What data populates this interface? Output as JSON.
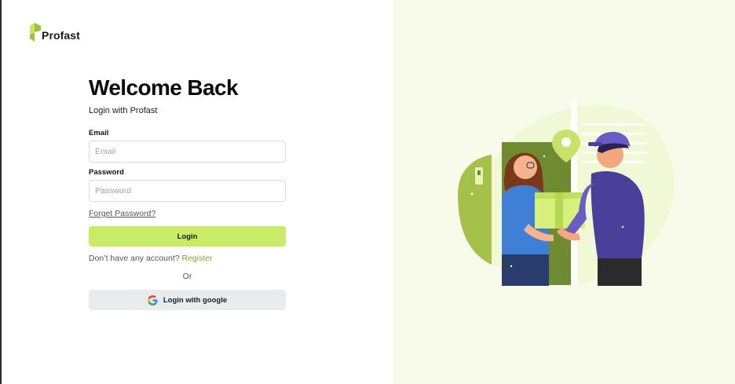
{
  "brand": {
    "name": "Profast",
    "accent_color": "#caeb66",
    "logo_icon": "profast-box-logo-icon"
  },
  "login": {
    "title": "Welcome Back",
    "subtitle": "Login with Profast",
    "email_label": "Email",
    "email_placeholder": "Email",
    "email_value": "",
    "password_label": "Password",
    "password_placeholder": "Password",
    "password_value": "",
    "forget_password": "Forget Password?",
    "login_button": "Login",
    "no_account_text": "Don’t have any account?",
    "register_link": "Register",
    "or_text": "Or",
    "google_button": "Login with google",
    "google_icon": "google-icon"
  },
  "illustration": {
    "icon": "delivery-handover-illustration",
    "colors": {
      "blob": "#f0f8d6",
      "door": "#6f8b32",
      "box": "#d7f07b",
      "uniform": "#4b3f9c",
      "woman_shirt": "#3f7fd6"
    }
  }
}
